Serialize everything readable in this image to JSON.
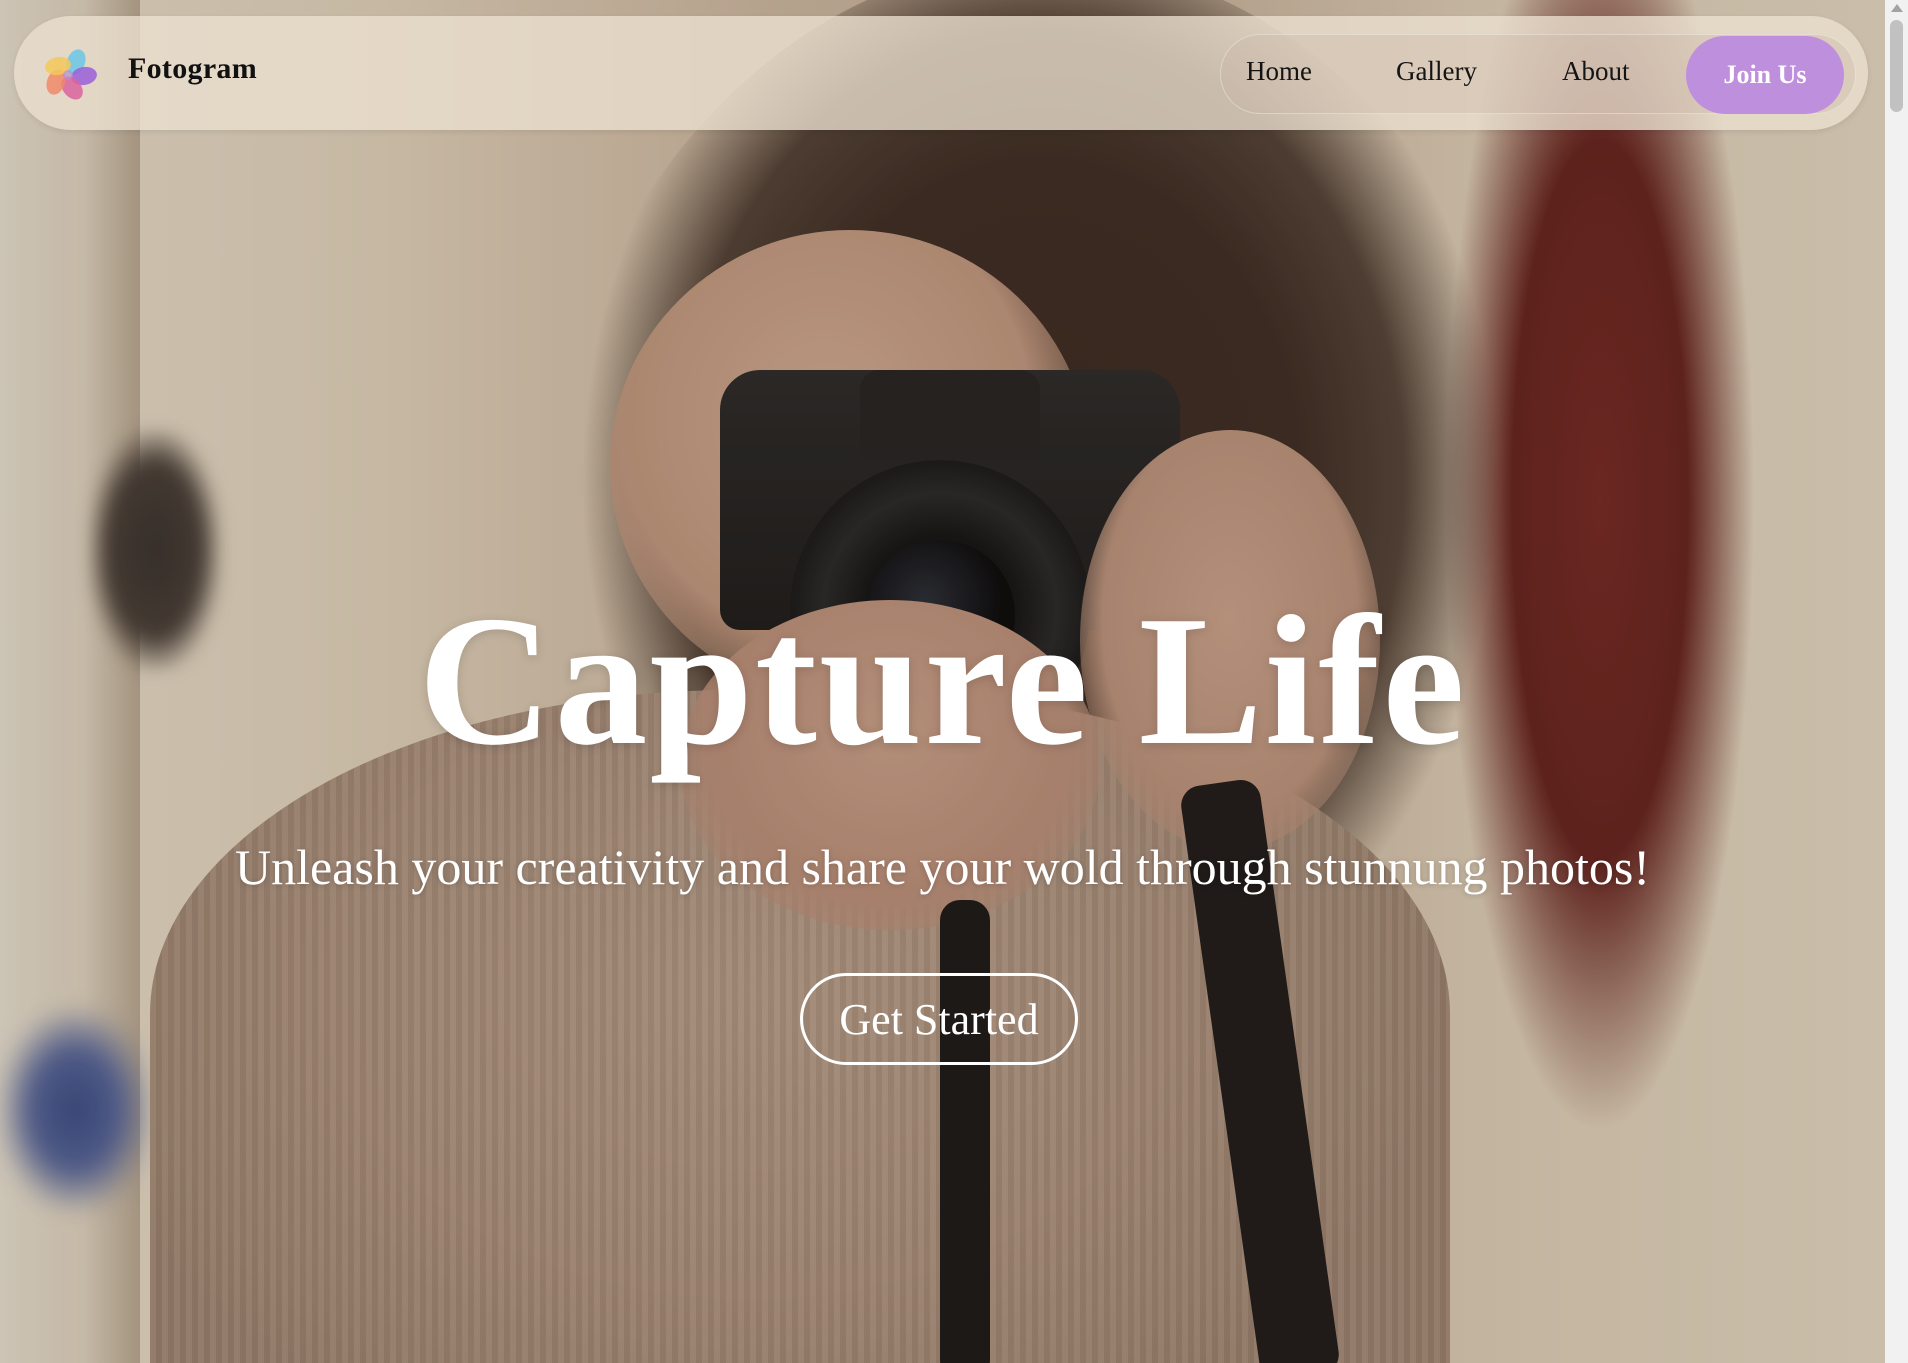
{
  "navbar": {
    "brand": "Fotogram",
    "logo_icon": "flower-logo-icon",
    "links": [
      {
        "label": "Home"
      },
      {
        "label": "Gallery"
      },
      {
        "label": "About"
      }
    ],
    "join_label": "Join Us",
    "join_color": "#be8fdc"
  },
  "hero": {
    "title": "Capture Life",
    "subtitle": "Unleash your creativity and share your wold through stunnung photos!",
    "cta_label": "Get Started",
    "background_image": "woman-holding-camera-photo"
  },
  "colors": {
    "accent": "#be8fdc",
    "hero_text": "#ffffff",
    "nav_text": "#141414"
  }
}
